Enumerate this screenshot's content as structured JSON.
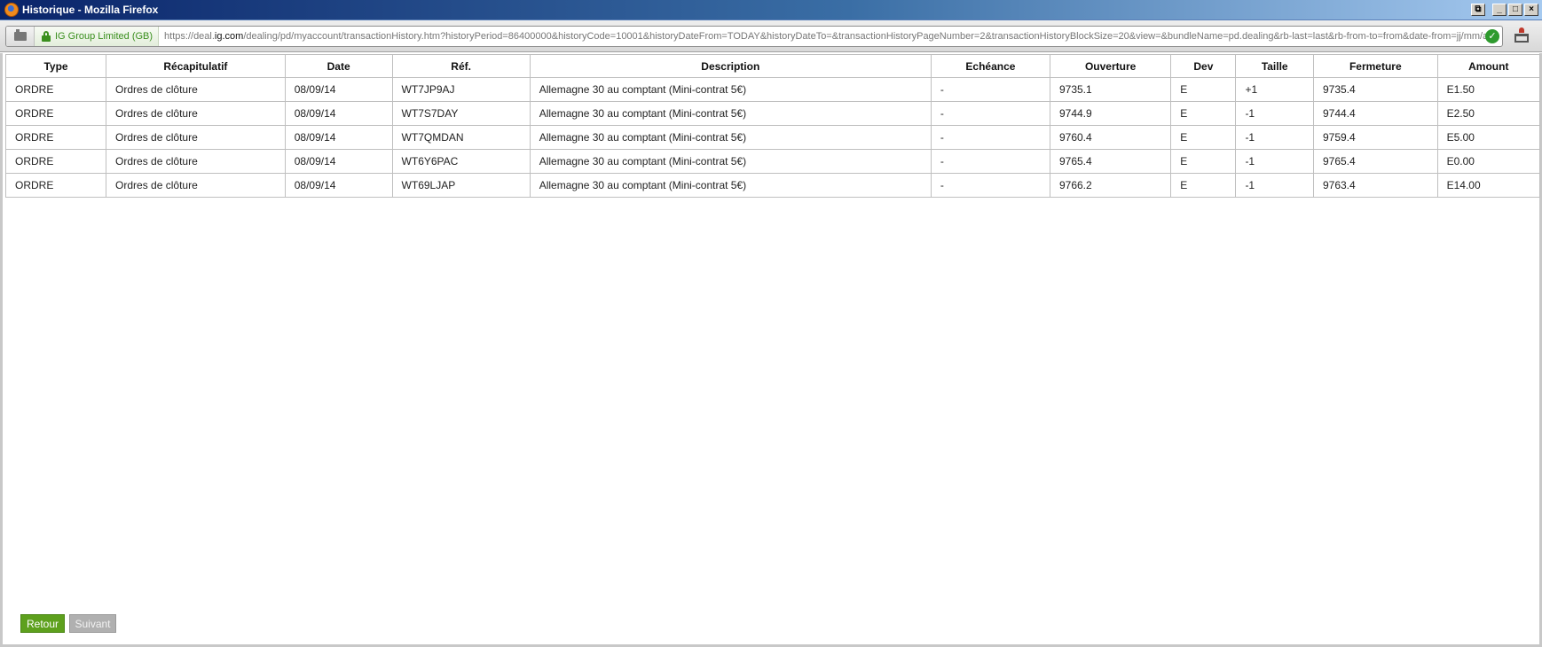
{
  "window": {
    "title": "Historique - Mozilla Firefox",
    "buttons": {
      "restore_extra": "⧉",
      "minimize": "_",
      "maximize": "□",
      "close": "×"
    }
  },
  "address_bar": {
    "identity_label": "IG Group Limited (GB)",
    "url_prefix": "https://deal.",
    "url_domain": "ig.com",
    "url_path": "/dealing/pd/myaccount/transactionHistory.htm?historyPeriod=86400000&historyCode=10001&historyDateFrom=TODAY&historyDateTo=&transactionHistoryPageNumber=2&transactionHistoryBlockSize=20&view=&bundleName=pd.dealing&rb-last=last&rb-from-to=from&date-from=jj/mm/a",
    "icons": [
      "page-icon",
      "lock-icon",
      "check-icon",
      "extension-icon"
    ]
  },
  "table": {
    "headers": [
      "Type",
      "Récapitulatif",
      "Date",
      "Réf.",
      "Description",
      "Echéance",
      "Ouverture",
      "Dev",
      "Taille",
      "Fermeture",
      "Amount"
    ],
    "rows": [
      [
        "ORDRE",
        "Ordres de clôture",
        "08/09/14",
        "WT7JP9AJ",
        "Allemagne 30 au comptant (Mini-contrat 5€)",
        "-",
        "9735.1",
        "E",
        "+1",
        "9735.4",
        "E1.50"
      ],
      [
        "ORDRE",
        "Ordres de clôture",
        "08/09/14",
        "WT7S7DAY",
        "Allemagne 30 au comptant (Mini-contrat 5€)",
        "-",
        "9744.9",
        "E",
        "-1",
        "9744.4",
        "E2.50"
      ],
      [
        "ORDRE",
        "Ordres de clôture",
        "08/09/14",
        "WT7QMDAN",
        "Allemagne 30 au comptant (Mini-contrat 5€)",
        "-",
        "9760.4",
        "E",
        "-1",
        "9759.4",
        "E5.00"
      ],
      [
        "ORDRE",
        "Ordres de clôture",
        "08/09/14",
        "WT6Y6PAC",
        "Allemagne 30 au comptant (Mini-contrat 5€)",
        "-",
        "9765.4",
        "E",
        "-1",
        "9765.4",
        "E0.00"
      ],
      [
        "ORDRE",
        "Ordres de clôture",
        "08/09/14",
        "WT69LJAP",
        "Allemagne 30 au comptant (Mini-contrat 5€)",
        "-",
        "9766.2",
        "E",
        "-1",
        "9763.4",
        "E14.00"
      ]
    ]
  },
  "pagination": {
    "back_label": "Retour",
    "next_label": "Suivant"
  },
  "colors": {
    "accent_green": "#5da01d",
    "disabled_gray": "#b0b0b0",
    "titlebar_blue": "#0a246a"
  }
}
